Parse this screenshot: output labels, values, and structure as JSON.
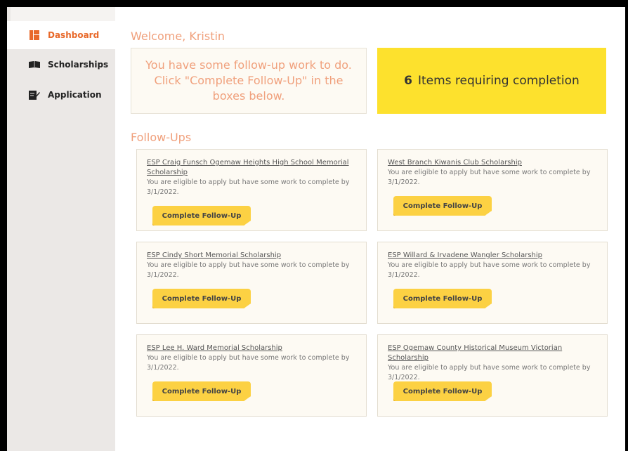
{
  "sidebar": {
    "items": [
      {
        "label": "Dashboard",
        "icon": "dashboard-icon",
        "active": true
      },
      {
        "label": "Scholarships",
        "icon": "book-icon",
        "active": false
      },
      {
        "label": "Application",
        "icon": "edit-icon",
        "active": false
      }
    ]
  },
  "main": {
    "welcome": "Welcome, Kristin",
    "message": "You have some follow-up work to do. Click \"Complete Follow-Up\" in the boxes below.",
    "count": "6",
    "count_label": "Items requiring completion",
    "followups_title": "Follow-Ups",
    "cards": [
      {
        "title": "ESP Craig Funsch Ogemaw Heights High School Memorial Scholarship",
        "desc": "You are eligible to apply but have some work to complete by 3/1/2022.",
        "button": "Complete Follow-Up"
      },
      {
        "title": "West Branch Kiwanis Club Scholarship",
        "desc": "You are eligible to apply but have some work to complete by 3/1/2022.",
        "button": "Complete Follow-Up"
      },
      {
        "title": "ESP Cindy Short Memorial Scholarship",
        "desc": "You are eligible to apply but have some work to complete by 3/1/2022.",
        "button": "Complete Follow-Up"
      },
      {
        "title": "ESP Willard & Irvadene Wangler Scholarship",
        "desc": "You are eligible to apply but have some work to complete by 3/1/2022.",
        "button": "Complete Follow-Up"
      },
      {
        "title": "ESP Lee H. Ward Memorial Scholarship",
        "desc": "You are eligible to apply but have some work to complete by 3/1/2022.",
        "button": "Complete Follow-Up"
      },
      {
        "title": "ESP Ogemaw County Historical Museum Victorian Scholarship",
        "desc": "You are eligible to apply but have some work to complete by 3/1/2022.",
        "button": "Complete Follow-Up"
      }
    ]
  },
  "colors": {
    "accent": "#e8692a",
    "heading": "#f0a07c",
    "highlight": "#fde12d",
    "button": "#fcd143"
  }
}
